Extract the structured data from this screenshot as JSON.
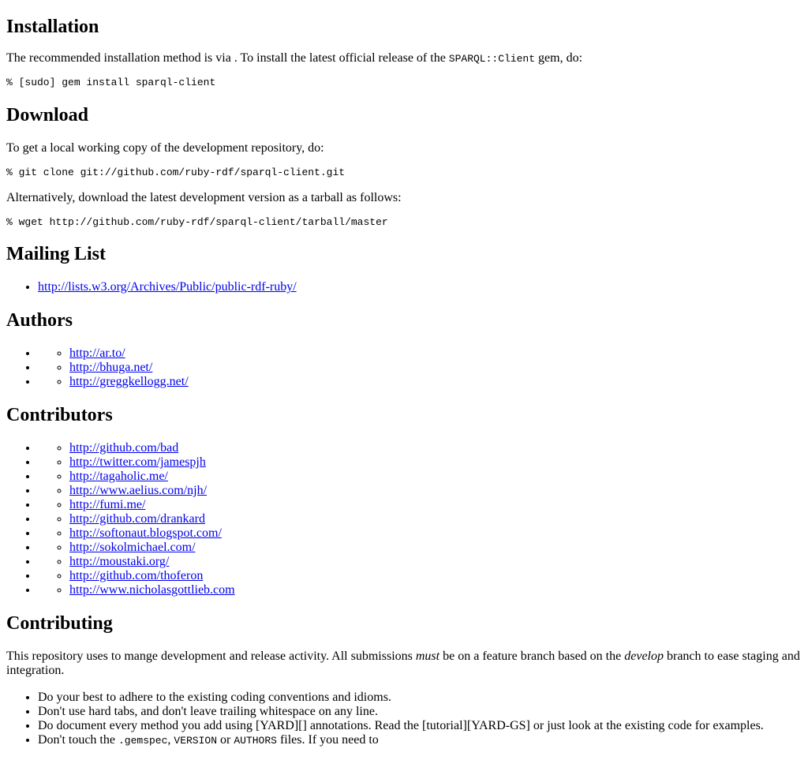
{
  "installation": {
    "heading": "Installation",
    "intro_before": "The recommended installation method is via . To install the latest official release of the ",
    "intro_code": "SPARQL::Client",
    "intro_after": " gem, do:",
    "command": "% [sudo] gem install sparql-client"
  },
  "download": {
    "heading": "Download",
    "intro": "To get a local working copy of the development repository, do:",
    "clone_command": "% git clone git://github.com/ruby-rdf/sparql-client.git",
    "alt_text": "Alternatively, download the latest development version as a tarball as follows:",
    "wget_command": "% wget http://github.com/ruby-rdf/sparql-client/tarball/master"
  },
  "mailing_list": {
    "heading": "Mailing List",
    "links": [
      "http://lists.w3.org/Archives/Public/public-rdf-ruby/"
    ]
  },
  "authors": {
    "heading": "Authors",
    "links": [
      "http://ar.to/",
      "http://bhuga.net/",
      "http://greggkellogg.net/"
    ]
  },
  "contributors": {
    "heading": "Contributors",
    "links": [
      "http://github.com/bad",
      "http://twitter.com/jamespjh",
      "http://tagaholic.me/",
      "http://www.aelius.com/njh/",
      "http://fumi.me/",
      "http://github.com/drankard",
      "http://softonaut.blogspot.com/",
      "http://sokolmichael.com/",
      "http://moustaki.org/",
      "http://github.com/thoferon",
      "http://www.nicholasgottlieb.com"
    ]
  },
  "contributing": {
    "heading": "Contributing",
    "p1": "This repository uses to mange development and release activity. All submissions ",
    "p_must": "must",
    "p2": " be on a feature branch based on the ",
    "p_develop": "develop",
    "p3": " branch to ease staging and integration.",
    "bullets": [
      "Do your best to adhere to the existing coding conventions and idioms.",
      "Don't use hard tabs, and don't leave trailing whitespace on any line.",
      "Do document every method you add using [YARD][] annotations. Read the [tutorial][YARD-GS] or just look at the existing code for examples."
    ],
    "last_before": "Don't touch the ",
    "last_code1": ".gemspec",
    "last_sep1": ", ",
    "last_code2": "VERSION",
    "last_sep2": " or ",
    "last_code3": "AUTHORS",
    "last_after": " files. If you need to"
  }
}
